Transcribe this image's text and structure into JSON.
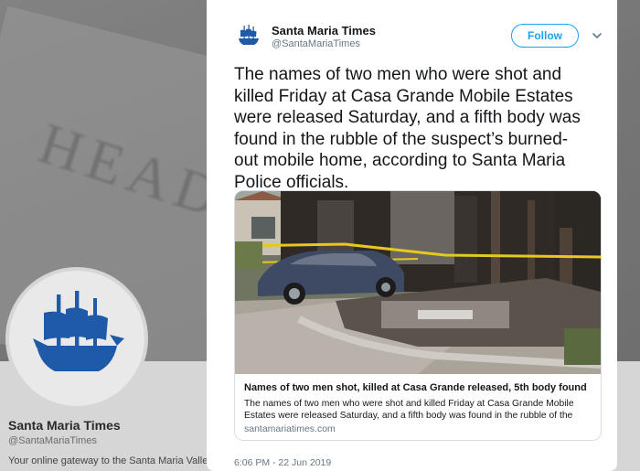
{
  "profile": {
    "name": "Santa Maria Times",
    "handle": "@SantaMariaTimes",
    "bio": "Your online gateway to the Santa Maria Valley."
  },
  "tweet": {
    "author_name": "Santa Maria Times",
    "author_handle": "@SantaMariaTimes",
    "follow_label": "Follow",
    "text": "The names of two men who were shot and killed Friday at Casa Grande Mobile Estates were released Saturday, and a fifth body was found in the rubble of the suspect’s burned-out mobile home, according to Santa Maria Police officials.",
    "timestamp": "6:06 PM - 22 Jun 2019"
  },
  "link_card": {
    "title": "Names of two men shot, killed at Casa Grande released, 5th body found",
    "description": "The names of two men who were shot and killed Friday at Casa Grande Mobile Estates were released Saturday, and a fifth body was found in the rubble of the",
    "domain": "santamariatimes.com"
  },
  "colors": {
    "accent": "#1da1f2",
    "logo_blue": "#1f5aa8"
  },
  "icons": [
    "ship-logo-icon",
    "chevron-down-icon"
  ]
}
